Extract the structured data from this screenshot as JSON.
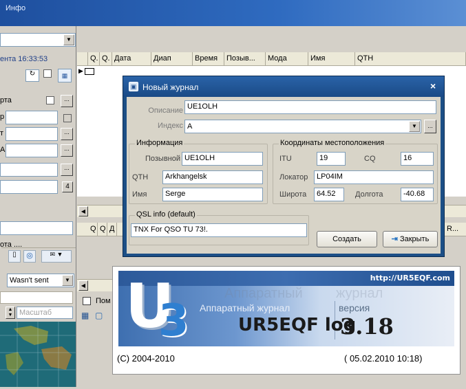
{
  "app": {
    "title": "Инфо",
    "time_label": "ента 16:33:53",
    "left_labels": {
      "karta": "рта",
      "r": "р",
      "t": "т",
      "a": "А",
      "ota": "ота ....",
      "masshtab": "Масштаб"
    },
    "stepper_value": "4",
    "qsl_combo": "Wasn't sent",
    "grid_columns": [
      "Q.",
      "Q.",
      "Дата",
      "Диап",
      "Время",
      "Позыв...",
      "Мода",
      "Имя",
      "QTH"
    ],
    "grid2_columns": [
      "Q",
      "Q",
      "Д"
    ],
    "grid2_tail": "R...",
    "panel_label": "Пом"
  },
  "dialog": {
    "title": "Новый журнал",
    "description_label": "Описание",
    "description_value": "UE1OLH",
    "index_label": "Индекс",
    "index_value": "A",
    "info_group": "Информация",
    "callsign_label": "Позывной",
    "callsign_value": "UE1OLH",
    "qth_label": "QTH",
    "qth_value": "Arkhangelsk",
    "name_label": "Имя",
    "name_value": "Serge",
    "coords_group": "Координаты местоположения",
    "itu_label": "ITU",
    "itu_value": "19",
    "cq_label": "CQ",
    "cq_value": "16",
    "locator_label": "Локатор",
    "locator_value": "LP04IM",
    "lat_label": "Широта",
    "lat_value": "64.52",
    "lon_label": "Долгота",
    "lon_value": "-40.68",
    "qsl_group": "QSL info (default)",
    "qsl_value": "TNX For QSO TU 73!.",
    "create_button": "Создать",
    "close_button": "Закрыть"
  },
  "splash": {
    "url": "http://UR5EQF.com",
    "logo_u": "U",
    "logo_3": "3",
    "watermark_left": "Аппаратный",
    "watermark_right": "журнал",
    "line1_left": "Аппаратный журнал",
    "line1_right": "версия",
    "product": "UR5EQF log",
    "version": "3.18",
    "copyright": "(C) 2004-2010",
    "build_date": "( 05.02.2010 10:18)"
  },
  "colors": {
    "title_bar": "#1e4f9e",
    "dialog_frame": "#1c4f86",
    "splash_gradient": "#3e6fb0"
  }
}
